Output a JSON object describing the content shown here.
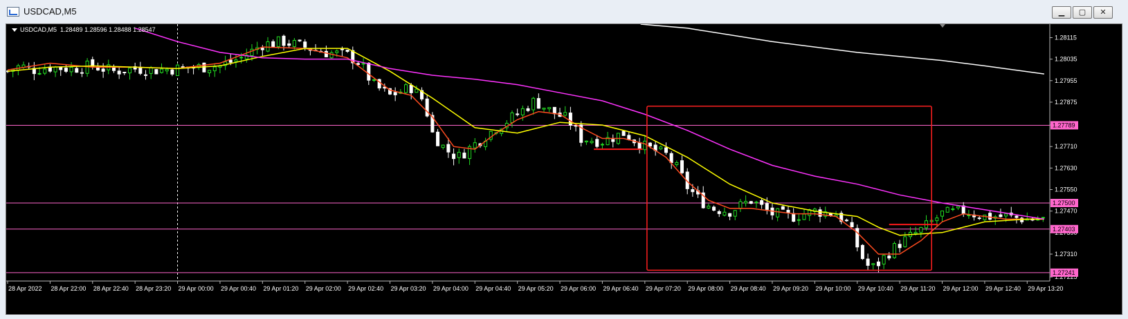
{
  "window": {
    "title": "USDCAD,M5",
    "buttons": {
      "minimize": "▁",
      "maximize": "▢",
      "close": "✕"
    }
  },
  "chart_header": {
    "symbol": "USDCAD,M5",
    "ohlc": "1.28489 1.28596 1.28488 1.28547"
  },
  "colors": {
    "background": "#000000",
    "bull": "#22dd22",
    "bear": "#ffffff",
    "ma_fast": "#ff4b1f",
    "ma_mid": "#ffff00",
    "ma_slow": "#ff33ff",
    "ma_long": "#ffffff",
    "hline": "#ff66cc",
    "box": "#ff2020",
    "level_marker": "#ff1a1a"
  },
  "chart_data": {
    "type": "candlestick",
    "symbol": "USDCAD",
    "timeframe": "M5",
    "y_ticks": [
      "1.28115",
      "1.28035",
      "1.27955",
      "1.27875",
      "1.27790",
      "1.27710",
      "1.27630",
      "1.27550",
      "1.27470",
      "1.27390",
      "1.27310",
      "1.27225"
    ],
    "x_ticks": [
      "28 Apr 2022",
      "28 Apr 22:00",
      "28 Apr 22:40",
      "28 Apr 23:20",
      "29 Apr 00:00",
      "29 Apr 00:40",
      "29 Apr 01:20",
      "29 Apr 02:00",
      "29 Apr 02:40",
      "29 Apr 03:20",
      "29 Apr 04:00",
      "29 Apr 04:40",
      "29 Apr 05:20",
      "29 Apr 06:00",
      "29 Apr 06:40",
      "29 Apr 07:20",
      "29 Apr 08:00",
      "29 Apr 08:40",
      "29 Apr 09:20",
      "29 Apr 10:00",
      "29 Apr 10:40",
      "29 Apr 11:20",
      "29 Apr 12:00",
      "29 Apr 12:40",
      "29 Apr 13:20"
    ],
    "ylim": [
      1.27215,
      1.28165
    ],
    "horizontal_lines": [
      {
        "price": 1.27789,
        "label": "1.27789"
      },
      {
        "price": 1.275,
        "label": "1.27500"
      },
      {
        "price": 1.27403,
        "label": "1.27403"
      },
      {
        "price": 1.27241,
        "label": "1.27241"
      }
    ],
    "close_path": [
      [
        0,
        1.2799
      ],
      [
        0.3,
        1.2801
      ],
      [
        0.6,
        1.27995
      ],
      [
        1.0,
        1.28005
      ],
      [
        1.5,
        1.28
      ],
      [
        2.0,
        1.2801
      ],
      [
        2.5,
        1.2799
      ],
      [
        3.0,
        1.28
      ],
      [
        3.5,
        1.27995
      ],
      [
        4.0,
        1.28
      ],
      [
        4.5,
        1.28005
      ],
      [
        5.0,
        1.2801
      ],
      [
        5.5,
        1.2804
      ],
      [
        6.0,
        1.2809
      ],
      [
        6.5,
        1.281
      ],
      [
        7.0,
        1.2808
      ],
      [
        7.5,
        1.2806
      ],
      [
        8.0,
        1.2805
      ],
      [
        8.3,
        1.2802
      ],
      [
        8.6,
        1.2794
      ],
      [
        9.0,
        1.279
      ],
      [
        9.5,
        1.2793
      ],
      [
        9.8,
        1.2788
      ],
      [
        10.0,
        1.2776
      ],
      [
        10.3,
        1.277
      ],
      [
        10.6,
        1.2767
      ],
      [
        11.0,
        1.2772
      ],
      [
        11.5,
        1.2778
      ],
      [
        12.0,
        1.2783
      ],
      [
        12.4,
        1.2788
      ],
      [
        12.8,
        1.2784
      ],
      [
        13.2,
        1.2781
      ],
      [
        13.5,
        1.2774
      ],
      [
        14.0,
        1.2773
      ],
      [
        14.5,
        1.2776
      ],
      [
        15.0,
        1.2771
      ],
      [
        15.5,
        1.2768
      ],
      [
        15.8,
        1.2762
      ],
      [
        16.0,
        1.2756
      ],
      [
        16.3,
        1.2751
      ],
      [
        16.6,
        1.2748
      ],
      [
        17.0,
        1.2747
      ],
      [
        17.5,
        1.2751
      ],
      [
        18.0,
        1.2746
      ],
      [
        18.5,
        1.2745
      ],
      [
        19.0,
        1.2747
      ],
      [
        19.5,
        1.2746
      ],
      [
        19.8,
        1.2742
      ],
      [
        20.0,
        1.2734
      ],
      [
        20.2,
        1.2727
      ],
      [
        20.4,
        1.2726
      ],
      [
        20.7,
        1.2731
      ],
      [
        21.0,
        1.2735
      ],
      [
        21.5,
        1.274
      ],
      [
        22.0,
        1.2746
      ],
      [
        22.5,
        1.2747
      ],
      [
        23.0,
        1.2745
      ],
      [
        23.5,
        1.2745
      ],
      [
        24.0,
        1.2744
      ],
      [
        24.4,
        1.2744
      ]
    ],
    "series": [
      {
        "name": "",
        "style": "fast",
        "points": [
          [
            0,
            1.27995
          ],
          [
            1,
            1.2802
          ],
          [
            2,
            1.28005
          ],
          [
            3,
            1.28005
          ],
          [
            4,
            1.28
          ],
          [
            5,
            1.2802
          ],
          [
            6,
            1.2808
          ],
          [
            7,
            1.28075
          ],
          [
            8,
            1.2804
          ],
          [
            8.5,
            1.2798
          ],
          [
            9,
            1.2792
          ],
          [
            9.5,
            1.279
          ],
          [
            10,
            1.2782
          ],
          [
            10.5,
            1.2771
          ],
          [
            11,
            1.277
          ],
          [
            11.5,
            1.2776
          ],
          [
            12,
            1.2781
          ],
          [
            12.5,
            1.2784
          ],
          [
            13,
            1.2783
          ],
          [
            13.5,
            1.2778
          ],
          [
            14,
            1.2774
          ],
          [
            14.5,
            1.2774
          ],
          [
            15,
            1.2772
          ],
          [
            15.5,
            1.2767
          ],
          [
            16,
            1.2758
          ],
          [
            16.5,
            1.2751
          ],
          [
            17,
            1.2748
          ],
          [
            17.5,
            1.2748
          ],
          [
            18,
            1.2747
          ],
          [
            18.5,
            1.2746
          ],
          [
            19,
            1.2746
          ],
          [
            19.5,
            1.2745
          ],
          [
            20,
            1.2739
          ],
          [
            20.5,
            1.2731
          ],
          [
            21,
            1.2731
          ],
          [
            21.5,
            1.2736
          ],
          [
            22,
            1.2743
          ],
          [
            22.5,
            1.2746
          ],
          [
            23,
            1.2745
          ],
          [
            23.5,
            1.2744
          ],
          [
            24,
            1.2744
          ],
          [
            24.4,
            1.2744
          ]
        ]
      },
      {
        "name": "",
        "style": "mid",
        "points": [
          [
            0,
            1.2799
          ],
          [
            1,
            1.28005
          ],
          [
            2,
            1.2801
          ],
          [
            3,
            1.28005
          ],
          [
            4,
            1.28
          ],
          [
            5,
            1.2801
          ],
          [
            6,
            1.28045
          ],
          [
            7,
            1.28075
          ],
          [
            8,
            1.28075
          ],
          [
            9,
            1.2799
          ],
          [
            10,
            1.2789
          ],
          [
            11,
            1.2778
          ],
          [
            12,
            1.2776
          ],
          [
            13,
            1.278
          ],
          [
            14,
            1.2779
          ],
          [
            15,
            1.2775
          ],
          [
            16,
            1.2767
          ],
          [
            17,
            1.2757
          ],
          [
            18,
            1.275
          ],
          [
            19,
            1.2747
          ],
          [
            20,
            1.2745
          ],
          [
            20.5,
            1.2741
          ],
          [
            21,
            1.2738
          ],
          [
            22,
            1.2739
          ],
          [
            23,
            1.2743
          ],
          [
            24,
            1.2744
          ],
          [
            24.4,
            1.2744
          ]
        ]
      },
      {
        "name": "",
        "style": "slow",
        "points": [
          [
            3,
            1.2815
          ],
          [
            4,
            1.281
          ],
          [
            5,
            1.2806
          ],
          [
            6,
            1.2804
          ],
          [
            7,
            1.28035
          ],
          [
            8,
            1.28035
          ],
          [
            9,
            1.28
          ],
          [
            10,
            1.27975
          ],
          [
            11,
            1.2796
          ],
          [
            12,
            1.2794
          ],
          [
            13,
            1.2791
          ],
          [
            14,
            1.2788
          ],
          [
            15,
            1.2783
          ],
          [
            16,
            1.2777
          ],
          [
            17,
            1.277
          ],
          [
            18,
            1.2764
          ],
          [
            19,
            1.276
          ],
          [
            20,
            1.2757
          ],
          [
            21,
            1.2753
          ],
          [
            22,
            1.275
          ],
          [
            23,
            1.27475
          ],
          [
            24,
            1.2745
          ],
          [
            24.4,
            1.2744
          ]
        ]
      },
      {
        "name": "",
        "style": "long",
        "points": [
          [
            14.9,
            1.28165
          ],
          [
            16,
            1.2815
          ],
          [
            18,
            1.281
          ],
          [
            20,
            1.2806
          ],
          [
            22,
            1.2803
          ],
          [
            23,
            1.2801
          ],
          [
            24.4,
            1.2798
          ]
        ]
      }
    ],
    "annotations": [
      {
        "type": "rectangle",
        "x0": 15.05,
        "x1": 21.75,
        "y0": 1.2786,
        "y1": 1.2725
      },
      {
        "type": "level",
        "x0": 13.8,
        "x1": 14.95,
        "y": 1.277
      },
      {
        "type": "level",
        "x0": 20.75,
        "x1": 21.9,
        "y": 1.2742
      }
    ],
    "vertical_marker": {
      "x": 4.0
    },
    "grid": false,
    "legend": "none"
  }
}
